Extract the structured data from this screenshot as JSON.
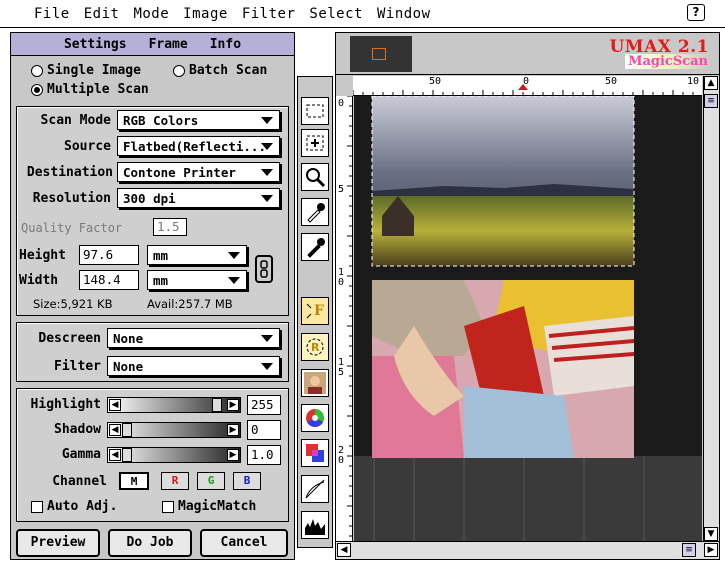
{
  "menubar": {
    "apple_glyph": "",
    "items": [
      "File",
      "Edit",
      "Mode",
      "Image",
      "Filter",
      "Select",
      "Window"
    ],
    "help_glyph": "?"
  },
  "panel": {
    "tabs": [
      "Settings",
      "Frame",
      "Info"
    ],
    "scan_type": {
      "single_label": "Single Image",
      "batch_label": "Batch Scan",
      "multiple_label": "Multiple Scan",
      "selected": "Multiple Scan"
    },
    "scan_mode": {
      "label": "Scan Mode",
      "value": "RGB Colors"
    },
    "source": {
      "label": "Source",
      "value": "Flatbed(Reflecti..."
    },
    "destination": {
      "label": "Destination",
      "value": "Contone Printer"
    },
    "resolution": {
      "label": "Resolution",
      "value": "300 dpi"
    },
    "quality": {
      "label": "Quality Factor",
      "value": "1.5"
    },
    "height": {
      "label": "Height",
      "value": "97.6",
      "unit": "mm"
    },
    "width": {
      "label": "Width",
      "value": "148.4",
      "unit": "mm"
    },
    "size_text": "Size:5,921 KB",
    "avail_text": "Avail:257.7 MB",
    "descreen": {
      "label": "Descreen",
      "value": "None"
    },
    "filter": {
      "label": "Filter",
      "value": "None"
    },
    "highlight": {
      "label": "Highlight",
      "value": "255"
    },
    "shadow": {
      "label": "Shadow",
      "value": "0"
    },
    "gamma": {
      "label": "Gamma",
      "value": "1.0"
    },
    "channel": {
      "label": "Channel",
      "buttons": [
        "M",
        "R",
        "G",
        "B"
      ]
    },
    "auto_adj_label": "Auto Adj.",
    "magicmatch_label": "MagicMatch",
    "buttons": {
      "preview": "Preview",
      "do_job": "Do Job",
      "cancel": "Cancel"
    }
  },
  "preview": {
    "logo_line1": "UMAX 2.1",
    "logo_line2": "MagicScan",
    "ruler_h_labels": [
      "50",
      "0",
      "50",
      "10"
    ],
    "ruler_v_labels": [
      "0",
      "5",
      "1\n0",
      "1\n5",
      "2\n0"
    ]
  },
  "colors": {
    "tabbar": "#b4b0d8",
    "logo_red": "#e01c1c",
    "red_channel": "#d01818",
    "green_channel": "#1a9a1a",
    "blue_channel": "#1a1ad0"
  }
}
